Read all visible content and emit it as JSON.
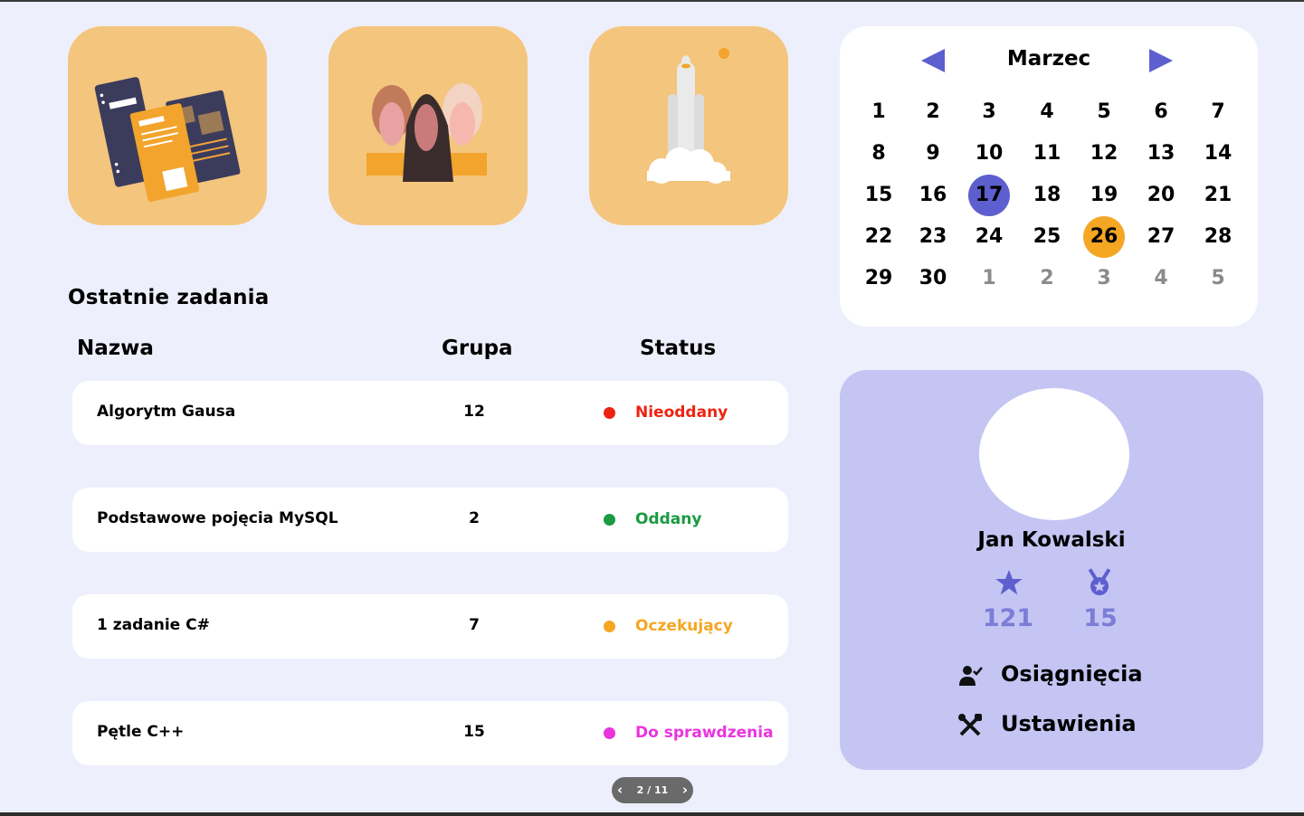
{
  "colors": {
    "background": "#eeeffc",
    "accent": "#5d5fcf",
    "highlight": "#f5a623",
    "profile_bg": "#c4c5f3",
    "stat_color": "#7b7dd6",
    "tile_bg": "#f4c57d"
  },
  "tiles": [
    {
      "icon": "documents-illustration-icon"
    },
    {
      "icon": "women-group-illustration-icon"
    },
    {
      "icon": "rocket-launch-illustration-icon"
    }
  ],
  "tasks": {
    "title": "Ostatnie zadania",
    "headers": {
      "name": "Nazwa",
      "group": "Grupa",
      "status": "Status"
    },
    "rows": [
      {
        "name": "Algorytm Gausa",
        "group": "12",
        "status": "Nieoddany",
        "color": "#ee2211"
      },
      {
        "name": "Podstawowe pojęcia MySQL",
        "group": "2",
        "status": "Oddany",
        "color": "#1a9a41"
      },
      {
        "name": "1 zadanie C#",
        "group": "7",
        "status": "Oczekujący",
        "color": "#f5a623"
      },
      {
        "name": "Pętle C++",
        "group": "15",
        "status": "Do sprawdzenia",
        "color": "#e934e0"
      }
    ]
  },
  "pager": {
    "label": "2 / 11"
  },
  "calendar": {
    "month": "Marzec",
    "selected_day": "17",
    "highlighted_day": "26",
    "weeks": [
      [
        "1",
        "2",
        "3",
        "4",
        "5",
        "6",
        "7"
      ],
      [
        "8",
        "9",
        "10",
        "11",
        "12",
        "13",
        "14"
      ],
      [
        "15",
        "16",
        "17",
        "18",
        "19",
        "20",
        "21"
      ],
      [
        "22",
        "23",
        "24",
        "25",
        "26",
        "27",
        "28"
      ],
      [
        "29",
        "30",
        "1",
        "2",
        "3",
        "4",
        "5"
      ]
    ],
    "muted_days_in_last_week": [
      "1",
      "2",
      "3",
      "4",
      "5"
    ]
  },
  "profile": {
    "name": "Jan Kowalski",
    "stats": [
      {
        "icon": "star-icon",
        "value": "121"
      },
      {
        "icon": "medal-icon",
        "value": "15"
      }
    ],
    "menu": [
      {
        "icon": "user-check-icon",
        "label": "Osiągnięcia"
      },
      {
        "icon": "tools-icon",
        "label": "Ustawienia"
      }
    ]
  }
}
